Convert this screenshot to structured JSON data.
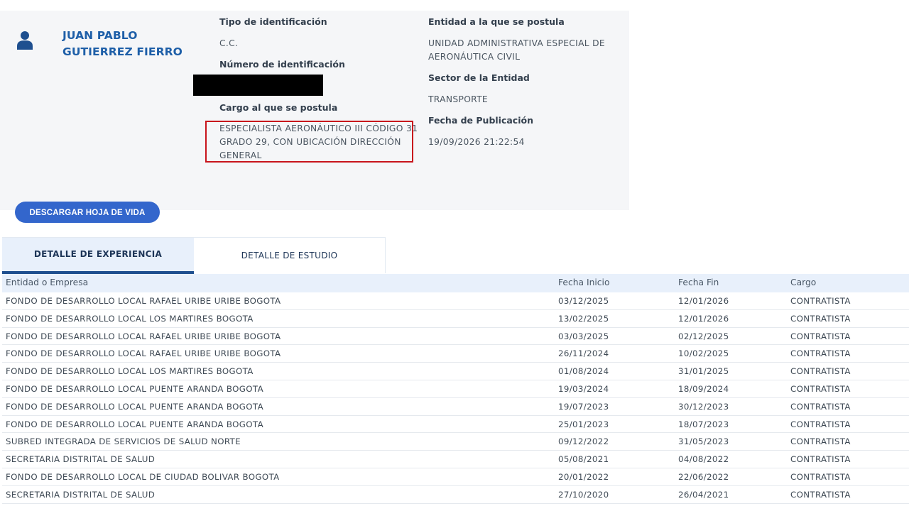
{
  "profile": {
    "name_line1": "JUAN PABLO",
    "name_line2": "GUTIERREZ FIERRO",
    "avatar_icon": "user-icon"
  },
  "fields": {
    "id_type_label": "Tipo de identificación",
    "id_type_value": "C.C.",
    "id_number_label": "Número de identificación",
    "position_label": "Cargo al que se postula",
    "position_value_line1": "ESPECIALISTA AERONÁUTICO III CÓDIGO 31",
    "position_value_line2": "GRADO 29, CON UBICACIÓN DIRECCIÓN",
    "position_value_line3": "GENERAL",
    "entity_label": "Entidad a la que se postula",
    "entity_value_line1": "UNIDAD ADMINISTRATIVA ESPECIAL DE",
    "entity_value_line2": "AERONÁUTICA CIVIL",
    "sector_label": "Sector de la Entidad",
    "sector_value": "TRANSPORTE",
    "pub_date_label": "Fecha de Publicación",
    "pub_date_value": "19/09/2026 21:22:54"
  },
  "actions": {
    "download_label": "DESCARGAR HOJA DE VIDA"
  },
  "tabs": [
    {
      "label": "DETALLE DE EXPERIENCIA",
      "active": true
    },
    {
      "label": "DETALLE DE ESTUDIO",
      "active": false
    }
  ],
  "table": {
    "headers": [
      "Entidad o Empresa",
      "Fecha Inicio",
      "Fecha Fin",
      "Cargo"
    ],
    "rows": [
      [
        "FONDO DE DESARROLLO LOCAL RAFAEL URIBE URIBE BOGOTA",
        "03/12/2025",
        "12/01/2026",
        "CONTRATISTA"
      ],
      [
        "FONDO DE DESARROLLO LOCAL LOS MARTIRES BOGOTA",
        "13/02/2025",
        "12/01/2026",
        "CONTRATISTA"
      ],
      [
        "FONDO DE DESARROLLO LOCAL RAFAEL URIBE URIBE BOGOTA",
        "03/03/2025",
        "02/12/2025",
        "CONTRATISTA"
      ],
      [
        "FONDO DE DESARROLLO LOCAL RAFAEL URIBE URIBE BOGOTA",
        "26/11/2024",
        "10/02/2025",
        "CONTRATISTA"
      ],
      [
        "FONDO DE DESARROLLO LOCAL LOS MARTIRES BOGOTA",
        "01/08/2024",
        "31/01/2025",
        "CONTRATISTA"
      ],
      [
        "FONDO DE DESARROLLO LOCAL PUENTE ARANDA BOGOTA",
        "19/03/2024",
        "18/09/2024",
        "CONTRATISTA"
      ],
      [
        "FONDO DE DESARROLLO LOCAL PUENTE ARANDA BOGOTA",
        "19/07/2023",
        "30/12/2023",
        "CONTRATISTA"
      ],
      [
        "FONDO DE DESARROLLO LOCAL PUENTE ARANDA BOGOTA",
        "25/01/2023",
        "18/07/2023",
        "CONTRATISTA"
      ],
      [
        "SUBRED INTEGRADA DE SERVICIOS DE SALUD NORTE",
        "09/12/2022",
        "31/05/2023",
        "CONTRATISTA"
      ],
      [
        "SECRETARIA DISTRITAL DE SALUD",
        "05/08/2021",
        "04/08/2022",
        "CONTRATISTA"
      ],
      [
        "FONDO DE DESARROLLO LOCAL DE CIUDAD BOLIVAR BOGOTA",
        "20/01/2022",
        "22/06/2022",
        "CONTRATISTA"
      ],
      [
        "SECRETARIA DISTRITAL DE SALUD",
        "27/10/2020",
        "26/04/2021",
        "CONTRATISTA"
      ]
    ]
  },
  "colors": {
    "accent": "#3366cc",
    "name": "#1e5fa8",
    "highlight": "#c8141c",
    "card_bg": "#f5f6f8",
    "table_header_bg": "#e8f0fb"
  }
}
